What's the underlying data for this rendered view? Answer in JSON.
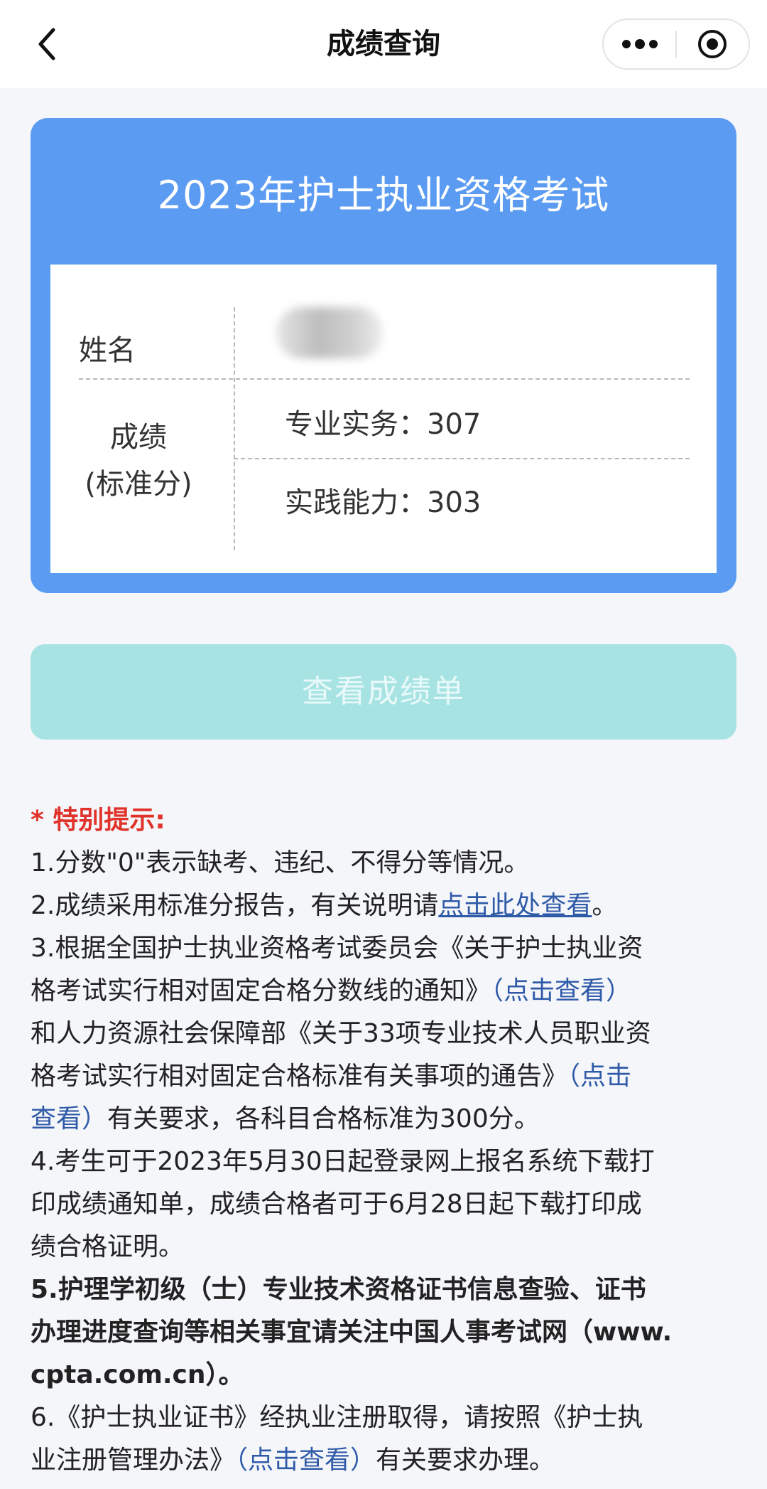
{
  "navbar": {
    "title": "成绩查询",
    "back_icon": "chevron-left-icon",
    "more_icon": "more-dots-icon",
    "close_icon": "target-circle-icon"
  },
  "card": {
    "title": "2023年护士执业资格考试",
    "name_label": "姓名",
    "score_label_line1": "成绩",
    "score_label_line2": "(标准分)",
    "scores": [
      {
        "text": "专业实务：307"
      },
      {
        "text": "实践能力：303"
      }
    ]
  },
  "view_button": {
    "label": "查看成绩单"
  },
  "notes": {
    "title": "* 特别提示:",
    "n1": "1.分数\"0\"表示缺考、违纪、不得分等情况。",
    "n2_a": "2.成绩采用标准分报告，有关说明请",
    "n2_link": "点击此处查看",
    "n2_b": "。",
    "n3_l1": "3.根据全国护士执业资格考试委员会《关于护士执业资",
    "n3_l2a": "格考试实行相对固定合格分数线的通知》",
    "n3_l2_link": "（点击查看）",
    "n3_l3": "和人力资源社会保障部《关于33项专业技术人员职业资",
    "n3_l4a": "格考试实行相对固定合格标准有关事项的通告》",
    "n3_l4_link": "（点击",
    "n3_l5_link": "查看）",
    "n3_l5b": "有关要求，各科目合格标准为300分。",
    "n4_l1": "4.考生可于2023年5月30日起登录网上报名系统下载打",
    "n4_l2": "印成绩通知单，成绩合格者可于6月28日起下载打印成",
    "n4_l3": "绩合格证明。",
    "n5_l1": "5.护理学初级（士）专业技术资格证书信息查验、证书",
    "n5_l2": "办理进度查询等相关事宜请关注中国人事考试网（www.",
    "n5_l3": "cpta.com.cn）。",
    "n6_l1": "6.《护士执业证书》经执业注册取得，请按照《护士执",
    "n6_l2a": "业注册管理办法》",
    "n6_l2_link": "（点击查看）",
    "n6_l2b": "有关要求办理。"
  },
  "colors": {
    "card_blue": "#5b9cf2",
    "button_teal": "#a8e3e4",
    "link_blue": "#2f5aa8",
    "notice_red": "#e0332b"
  }
}
